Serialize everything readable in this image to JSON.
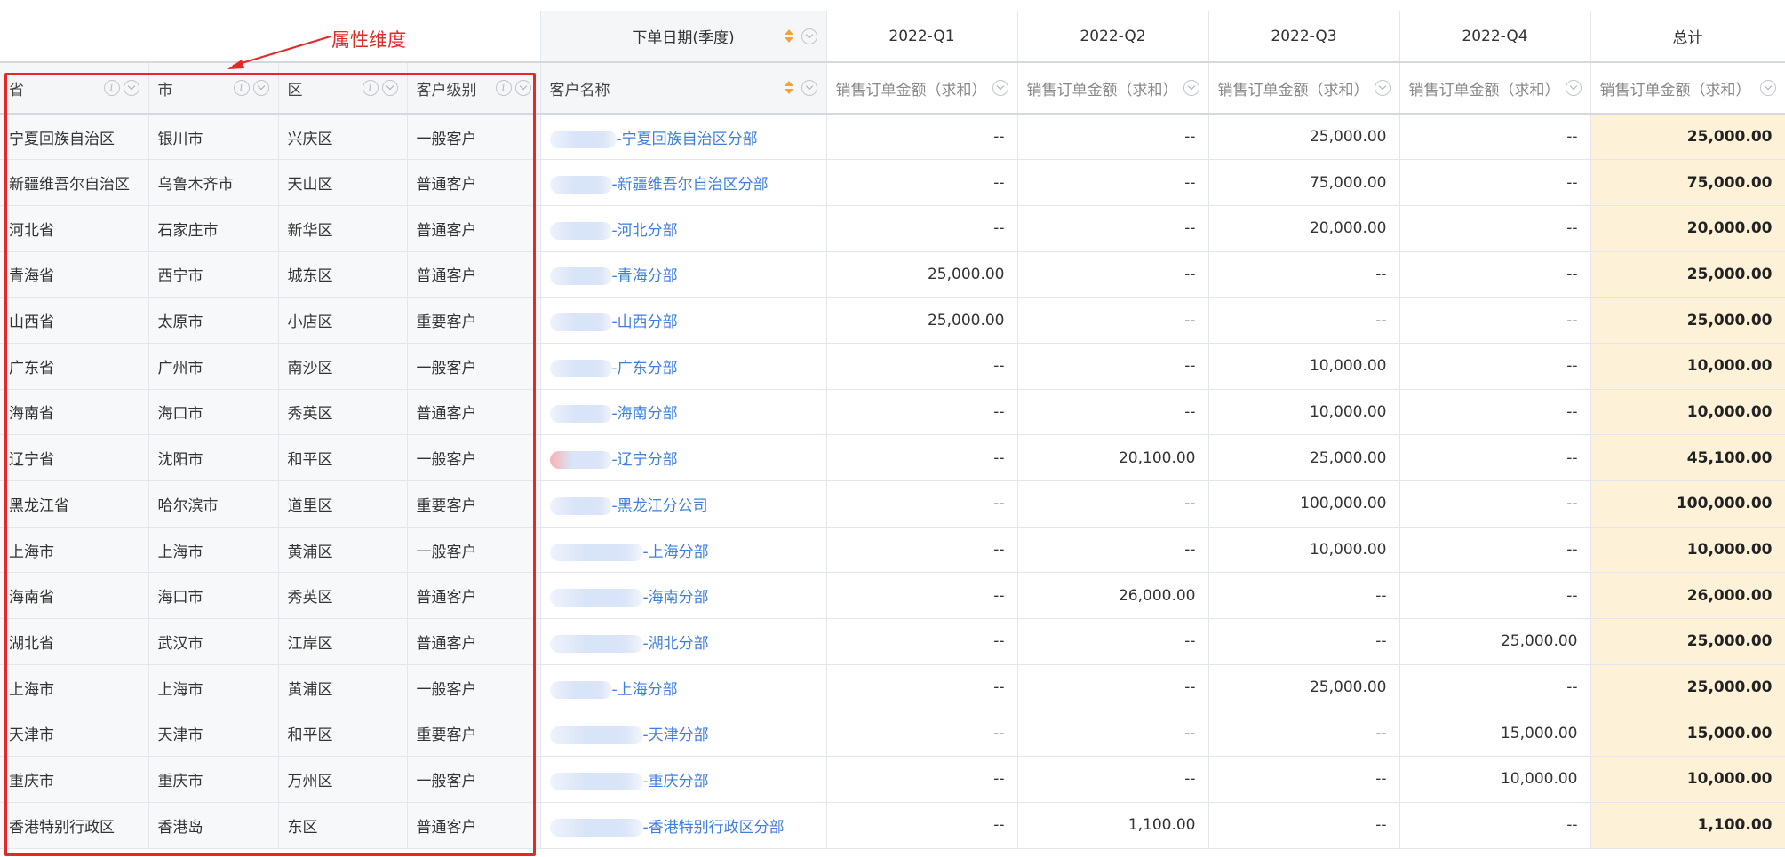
{
  "annotation": {
    "label": "属性维度",
    "color": "#e62828"
  },
  "header_top": {
    "blank": "",
    "date_dimension": "下单日期(季度)",
    "quarters": [
      "2022-Q1",
      "2022-Q2",
      "2022-Q3",
      "2022-Q4"
    ],
    "total": "总计"
  },
  "header_fields": {
    "province": "省",
    "city": "市",
    "district": "区",
    "customer_level": "客户级别",
    "customer_name": "客户名称",
    "measure": "销售订单金额（求和）"
  },
  "colors": {
    "link": "#3d7fe0",
    "total_bg": "#fdf2d8",
    "sort_icon": "#f3a23a"
  },
  "rows": [
    {
      "province": "宁夏回族自治区",
      "city": "银川市",
      "district": "兴庆区",
      "level": "一般客户",
      "customer": "-宁夏回族自治区分部",
      "blur": 75,
      "q1": "--",
      "q2": "--",
      "q3": "25,000.00",
      "q4": "--",
      "total": "25,000.00"
    },
    {
      "province": "新疆维吾尔自治区",
      "city": "乌鲁木齐市",
      "district": "天山区",
      "level": "普通客户",
      "customer": "-新疆维吾尔自治区分部",
      "blur": 70,
      "q1": "--",
      "q2": "--",
      "q3": "75,000.00",
      "q4": "--",
      "total": "75,000.00"
    },
    {
      "province": "河北省",
      "city": "石家庄市",
      "district": "新华区",
      "level": "普通客户",
      "customer": "-河北分部",
      "blur": 70,
      "q1": "--",
      "q2": "--",
      "q3": "20,000.00",
      "q4": "--",
      "total": "20,000.00"
    },
    {
      "province": "青海省",
      "city": "西宁市",
      "district": "城东区",
      "level": "普通客户",
      "customer": "-青海分部",
      "blur": 70,
      "q1": "25,000.00",
      "q2": "--",
      "q3": "--",
      "q4": "--",
      "total": "25,000.00"
    },
    {
      "province": "山西省",
      "city": "太原市",
      "district": "小店区",
      "level": "重要客户",
      "customer": "-山西分部",
      "blur": 70,
      "q1": "25,000.00",
      "q2": "--",
      "q3": "--",
      "q4": "--",
      "total": "25,000.00"
    },
    {
      "province": "广东省",
      "city": "广州市",
      "district": "南沙区",
      "level": "一般客户",
      "customer": "-广东分部",
      "blur": 70,
      "q1": "--",
      "q2": "--",
      "q3": "10,000.00",
      "q4": "--",
      "total": "10,000.00"
    },
    {
      "province": "海南省",
      "city": "海口市",
      "district": "秀英区",
      "level": "普通客户",
      "customer": "-海南分部",
      "blur": 70,
      "q1": "--",
      "q2": "--",
      "q3": "10,000.00",
      "q4": "--",
      "total": "10,000.00"
    },
    {
      "province": "辽宁省",
      "city": "沈阳市",
      "district": "和平区",
      "level": "一般客户",
      "customer": "-辽宁分部",
      "blur": 70,
      "pink": true,
      "q1": "--",
      "q2": "20,100.00",
      "q3": "25,000.00",
      "q4": "--",
      "total": "45,100.00"
    },
    {
      "province": "黑龙江省",
      "city": "哈尔滨市",
      "district": "道里区",
      "level": "重要客户",
      "customer": "-黑龙江分公司",
      "blur": 70,
      "q1": "--",
      "q2": "--",
      "q3": "100,000.00",
      "q4": "--",
      "total": "100,000.00"
    },
    {
      "province": "上海市",
      "city": "上海市",
      "district": "黄浦区",
      "level": "一般客户",
      "customer": "-上海分部",
      "blur": 105,
      "q1": "--",
      "q2": "--",
      "q3": "10,000.00",
      "q4": "--",
      "total": "10,000.00"
    },
    {
      "province": "海南省",
      "city": "海口市",
      "district": "秀英区",
      "level": "普通客户",
      "customer": "-海南分部",
      "blur": 105,
      "q1": "--",
      "q2": "26,000.00",
      "q3": "--",
      "q4": "--",
      "total": "26,000.00"
    },
    {
      "province": "湖北省",
      "city": "武汉市",
      "district": "江岸区",
      "level": "普通客户",
      "customer": "-湖北分部",
      "blur": 105,
      "q1": "--",
      "q2": "--",
      "q3": "--",
      "q4": "25,000.00",
      "total": "25,000.00"
    },
    {
      "province": "上海市",
      "city": "上海市",
      "district": "黄浦区",
      "level": "一般客户",
      "customer": "-上海分部",
      "blur": 70,
      "q1": "--",
      "q2": "--",
      "q3": "25,000.00",
      "q4": "--",
      "total": "25,000.00"
    },
    {
      "province": "天津市",
      "city": "天津市",
      "district": "和平区",
      "level": "重要客户",
      "customer": "-天津分部",
      "blur": 105,
      "q1": "--",
      "q2": "--",
      "q3": "--",
      "q4": "15,000.00",
      "total": "15,000.00"
    },
    {
      "province": "重庆市",
      "city": "重庆市",
      "district": "万州区",
      "level": "一般客户",
      "customer": "-重庆分部",
      "blur": 105,
      "q1": "--",
      "q2": "--",
      "q3": "--",
      "q4": "10,000.00",
      "total": "10,000.00"
    },
    {
      "province": "香港特别行政区",
      "city": "香港岛",
      "district": "东区",
      "level": "普通客户",
      "customer": "-香港特别行政区分部",
      "blur": 105,
      "q1": "--",
      "q2": "1,100.00",
      "q3": "--",
      "q4": "--",
      "total": "1,100.00"
    }
  ]
}
